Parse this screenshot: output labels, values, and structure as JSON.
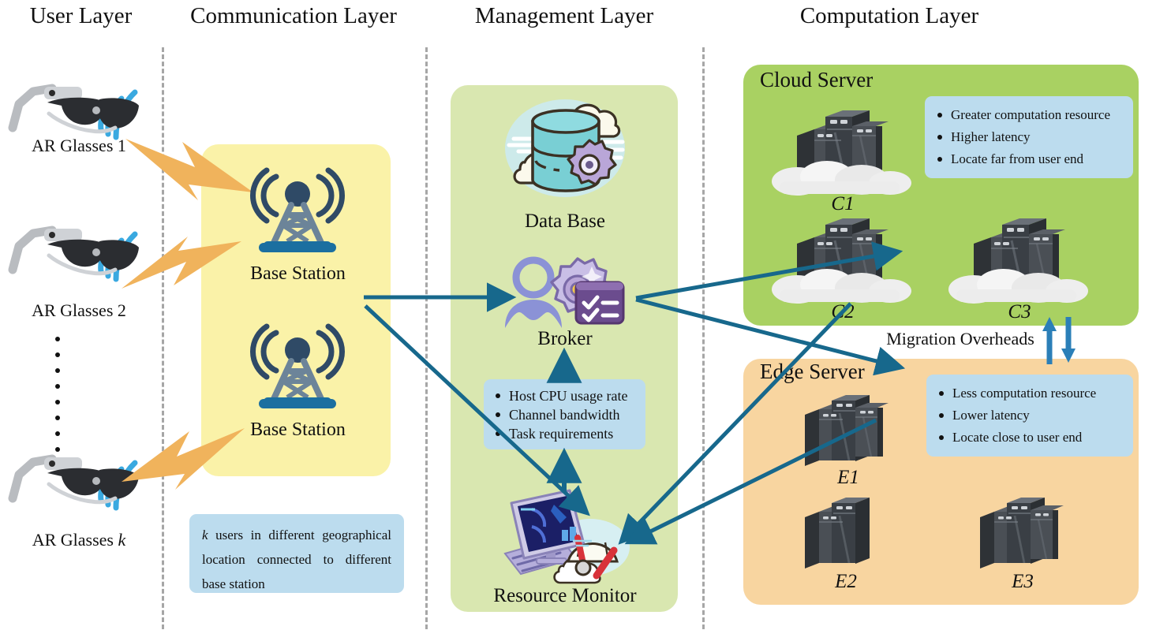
{
  "layers": [
    {
      "id": "user",
      "title": "User Layer"
    },
    {
      "id": "communication",
      "title": "Communication Layer"
    },
    {
      "id": "management",
      "title": "Management Layer"
    },
    {
      "id": "computation",
      "title": "Computation Layer"
    }
  ],
  "user_layer": {
    "devices": [
      {
        "label": "AR Glasses 1",
        "icon": "ar-glasses-icon"
      },
      {
        "label": "AR Glasses 2",
        "icon": "ar-glasses-icon"
      },
      {
        "label_prefix": "AR Glasses ",
        "label_italic": "k",
        "label": "AR Glasses k",
        "icon": "ar-glasses-icon"
      }
    ],
    "ellipsis_dot_count": 8
  },
  "communication_layer": {
    "stations": [
      {
        "label": "Base Station",
        "icon": "cell-tower-icon"
      },
      {
        "label": "Base Station",
        "icon": "cell-tower-icon"
      }
    ],
    "note": {
      "italic_lead": "k",
      "text": " users in different geographical location connected to different base station",
      "full_text": "k users in different geographical location connected to different base station"
    }
  },
  "management_layer": {
    "database": {
      "label": "Data Base",
      "icon": "database-cloud-icon"
    },
    "broker": {
      "label": "Broker",
      "icon": "broker-person-gear-icon"
    },
    "metrics_box": {
      "items": [
        "Host CPU usage rate",
        "Channel bandwidth",
        "Task requirements"
      ]
    },
    "resource_monitor": {
      "label": "Resource Monitor",
      "icon": "monitor-gauge-icon"
    }
  },
  "computation_layer": {
    "cloud": {
      "title": "Cloud Server",
      "features": [
        "Greater computation resource",
        "Higher latency",
        "Locate far from user end"
      ],
      "nodes": [
        {
          "label": "C1",
          "icon": "server-rack-cloud-icon"
        },
        {
          "label": "C2",
          "icon": "server-rack-cloud-icon"
        },
        {
          "label": "C3",
          "icon": "server-rack-cloud-icon"
        }
      ]
    },
    "edge": {
      "title": "Edge Server",
      "features": [
        "Less computation resource",
        "Lower latency",
        "Locate close to user end"
      ],
      "nodes": [
        {
          "label": "E1",
          "icon": "server-rack-icon"
        },
        {
          "label": "E2",
          "icon": "server-rack-icon"
        },
        {
          "label": "E3",
          "icon": "server-rack-icon"
        }
      ]
    },
    "migration_label": "Migration Overheads"
  },
  "colors": {
    "comm_panel": "#faf2a8",
    "mgmt_panel": "#d9e7b0",
    "cloud_panel": "#a9d162",
    "edge_panel": "#f8d5a0",
    "infobox": "#bcdcee",
    "arrow": "#17688c",
    "bolt": "#f0b35c",
    "wifi": "#3aa9e0",
    "divider": "#a6a6a6",
    "server_dark": "#3a3f45",
    "cloud_white": "#eeeeee"
  }
}
